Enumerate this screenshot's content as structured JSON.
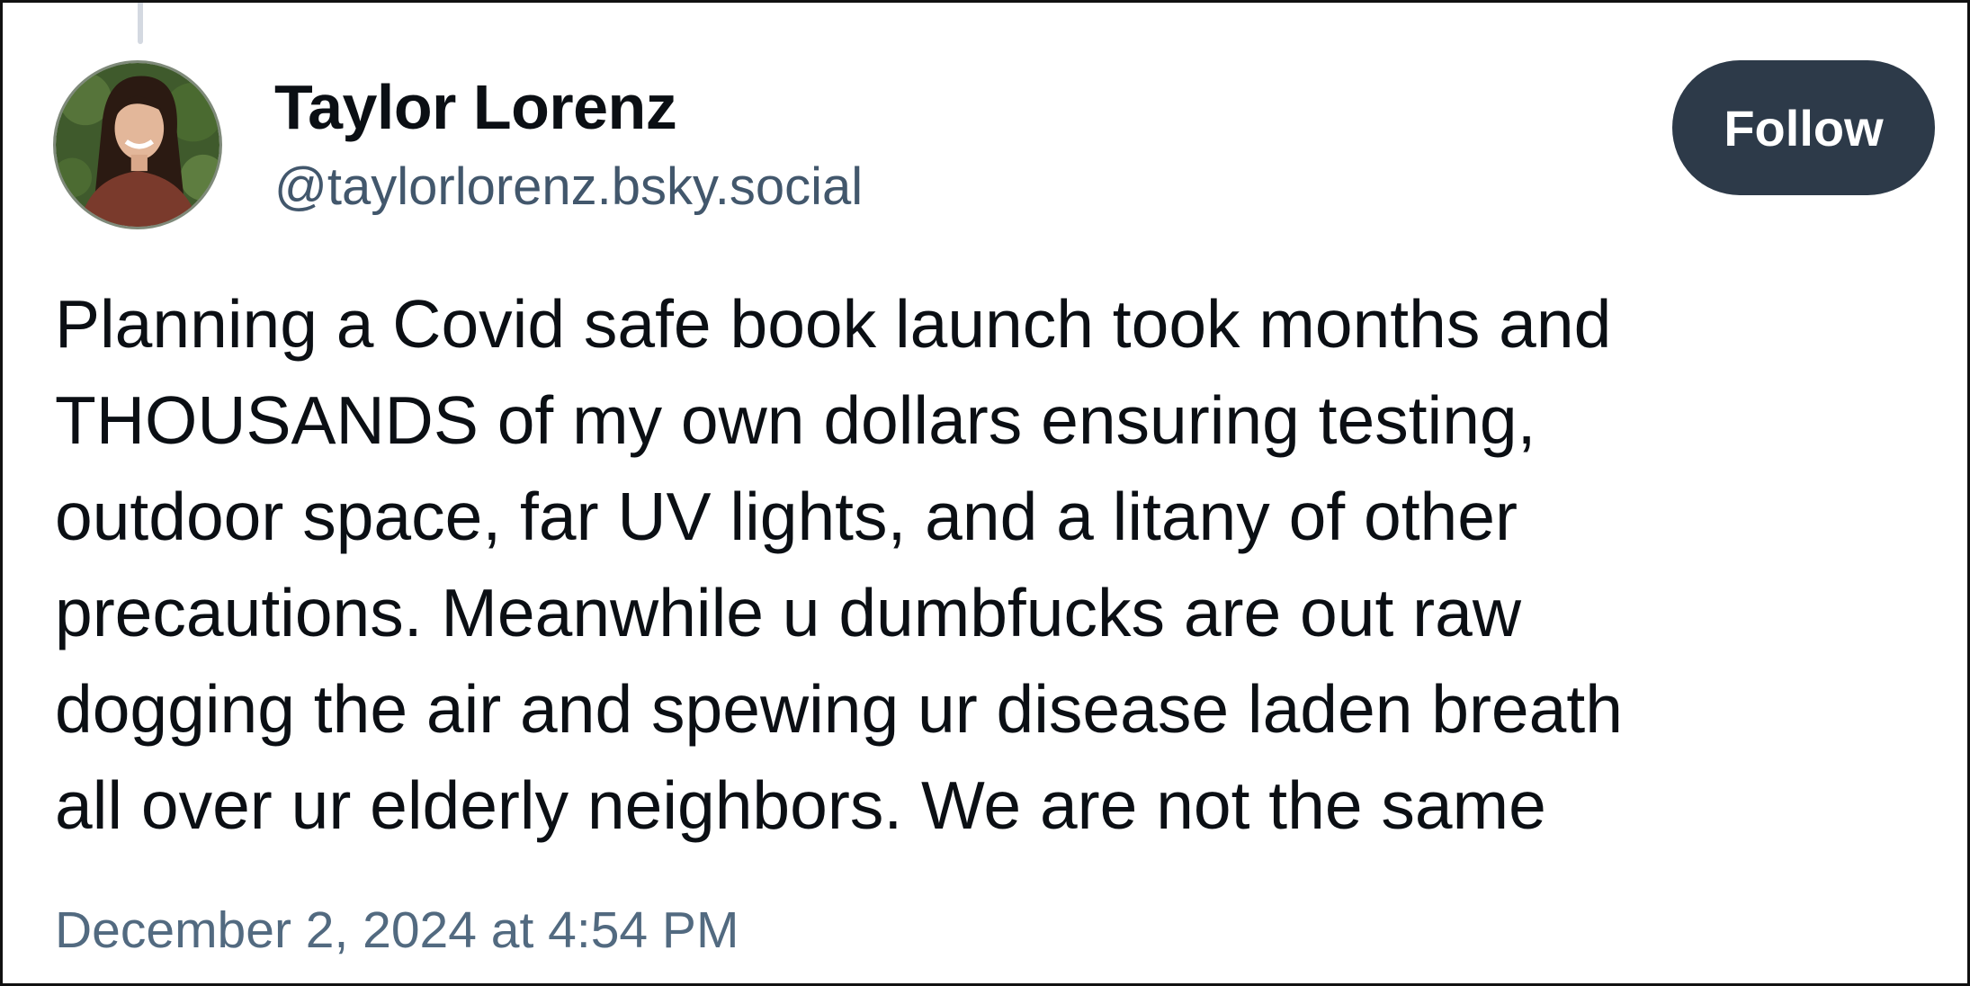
{
  "post": {
    "author": {
      "display_name": "Taylor Lorenz",
      "handle": "@taylorlorenz.bsky.social"
    },
    "follow_label": "Follow",
    "text_lines": [
      "Planning a Covid safe book launch took months and",
      "THOUSANDS of my own dollars ensuring testing,",
      "outdoor space, far UV lights, and a litany of other",
      "precautions. Meanwhile u dumbfucks are out raw",
      "dogging the air and spewing ur disease laden breath",
      "all over ur elderly neighbors. We are not the same"
    ],
    "timestamp": "December 2, 2024 at 4:54 PM"
  },
  "colors": {
    "follow_button_bg": "#2d3a49",
    "handle_text": "#42576c",
    "timestamp_text": "#526a80",
    "thread_line": "#d4d9e1"
  },
  "icons": {
    "avatar": "profile-photo"
  }
}
